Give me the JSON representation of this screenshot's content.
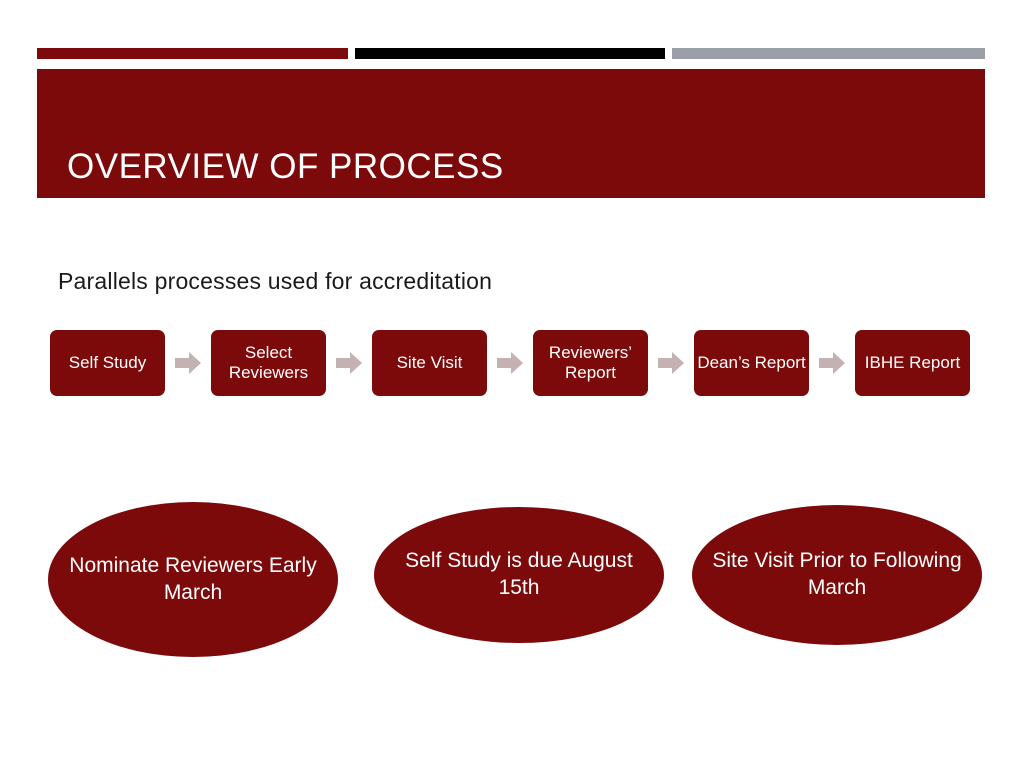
{
  "slide": {
    "title": "OVERVIEW OF PROCESS",
    "subtitle": "Parallels processes used for accreditation"
  },
  "colors": {
    "dark_red": "#7d0a0a",
    "black": "#000000",
    "gray": "#9ba0a8",
    "arrow": "#c4b2b2",
    "text_on_red": "#ffffff",
    "body_text": "#1a1a1a"
  },
  "decor_bars": [
    {
      "name": "red-bar",
      "color": "#7d0a0a"
    },
    {
      "name": "black-bar",
      "color": "#000000"
    },
    {
      "name": "gray-bar",
      "color": "#9ba0a8"
    }
  ],
  "process_flow": {
    "steps": [
      {
        "label": "Self Study"
      },
      {
        "label": "Select Reviewers"
      },
      {
        "label": "Site Visit"
      },
      {
        "label": "Reviewers’ Report"
      },
      {
        "label": "Dean’s Report"
      },
      {
        "label": "IBHE Report"
      }
    ],
    "arrow_icon": "arrow-right-icon",
    "arrow_count": 5
  },
  "milestones": [
    {
      "label": "Nominate Reviewers Early March"
    },
    {
      "label": "Self Study is due August 15th"
    },
    {
      "label": "Site Visit Prior to Following March"
    }
  ]
}
